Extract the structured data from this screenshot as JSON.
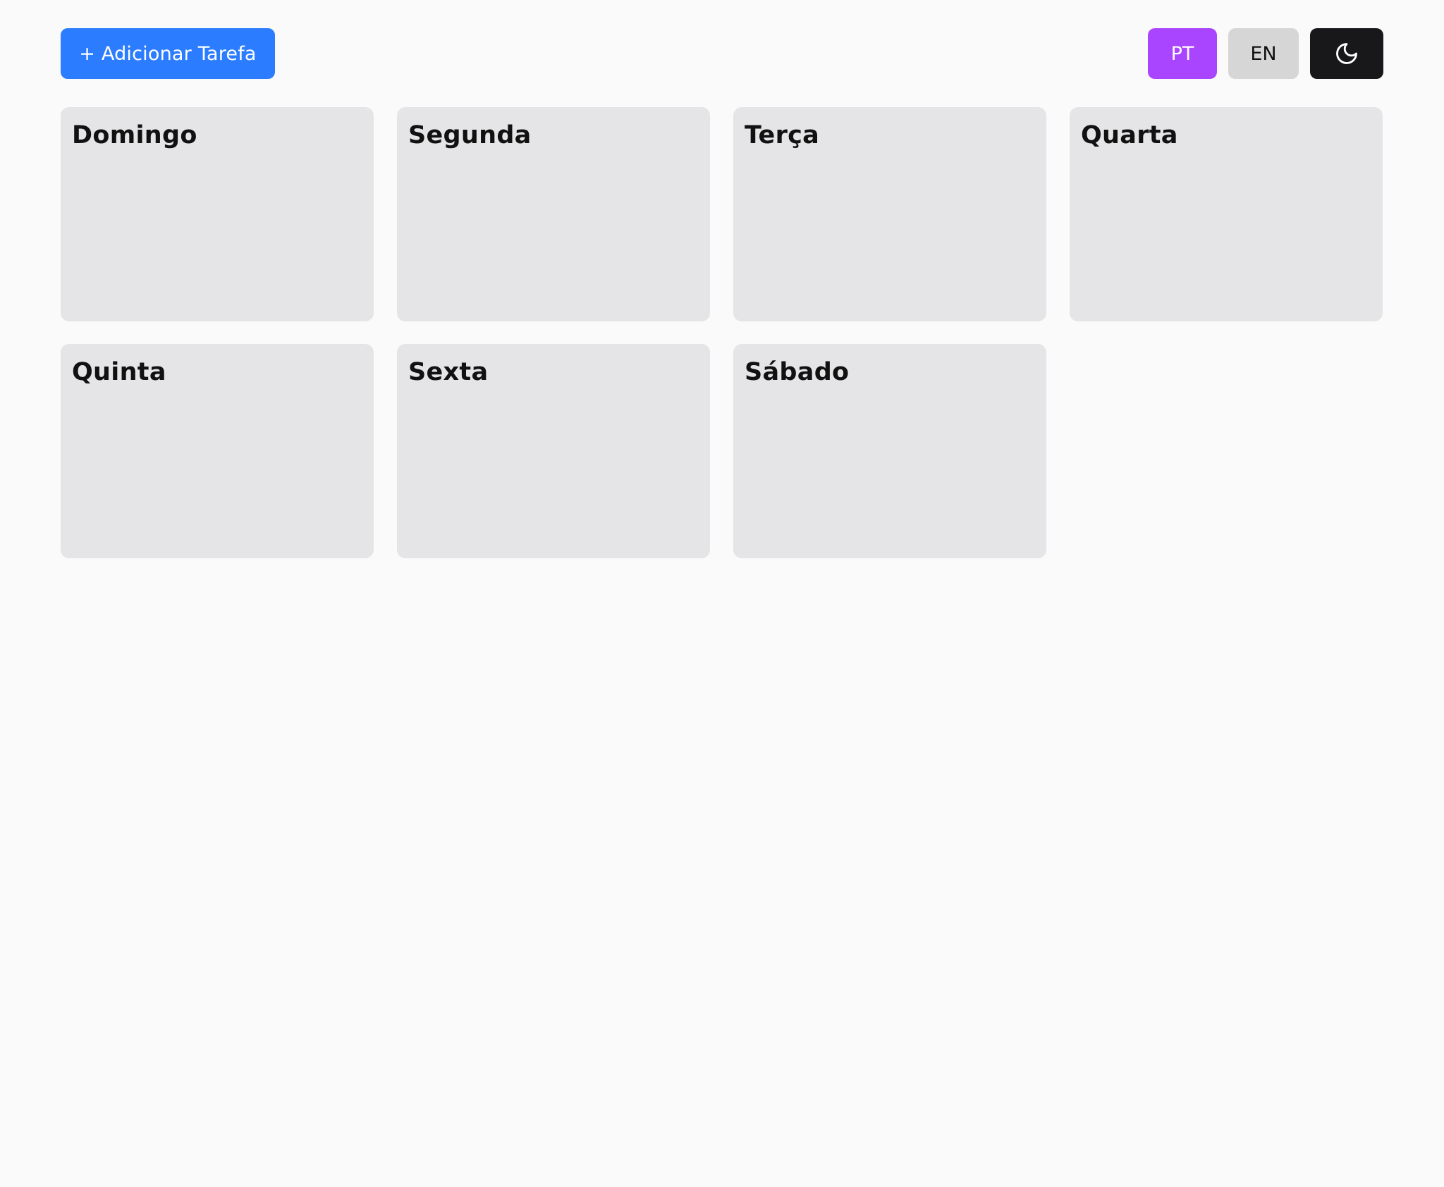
{
  "toolbar": {
    "add_task_label": "+ Adicionar Tarefa",
    "lang_pt_label": "PT",
    "lang_en_label": "EN",
    "theme_icon": "moon-icon"
  },
  "days": [
    {
      "label": "Domingo"
    },
    {
      "label": "Segunda"
    },
    {
      "label": "Terça"
    },
    {
      "label": "Quarta"
    },
    {
      "label": "Quinta"
    },
    {
      "label": "Sexta"
    },
    {
      "label": "Sábado"
    }
  ],
  "colors": {
    "background": "#fafafa",
    "primary_button": "#2b7cff",
    "active_language": "#a944ff",
    "inactive_language": "#d6d6d6",
    "theme_button": "#18181b",
    "card": "#e5e5e7",
    "text": "#111111",
    "on_primary": "#ffffff"
  }
}
